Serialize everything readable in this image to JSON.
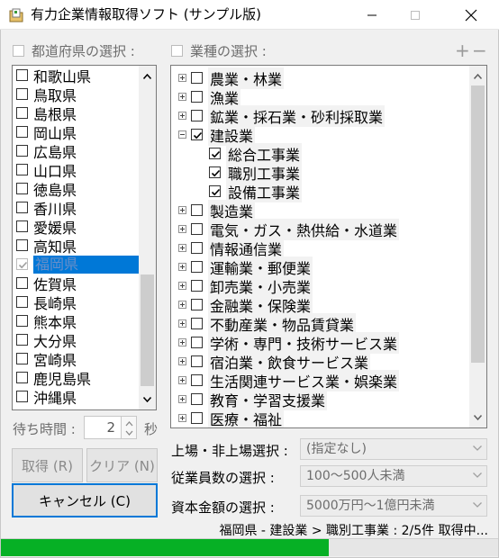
{
  "window": {
    "title": "有力企業情報取得ソフト (サンプル版)"
  },
  "prefectures": {
    "header": "都道府県の選択 :",
    "items": [
      {
        "label": "和歌山県",
        "checked": false
      },
      {
        "label": "鳥取県",
        "checked": false
      },
      {
        "label": "島根県",
        "checked": false
      },
      {
        "label": "岡山県",
        "checked": false
      },
      {
        "label": "広島県",
        "checked": false
      },
      {
        "label": "山口県",
        "checked": false
      },
      {
        "label": "徳島県",
        "checked": false
      },
      {
        "label": "香川県",
        "checked": false
      },
      {
        "label": "愛媛県",
        "checked": false
      },
      {
        "label": "高知県",
        "checked": false
      },
      {
        "label": "福岡県",
        "checked": true,
        "selected": true
      },
      {
        "label": "佐賀県",
        "checked": false
      },
      {
        "label": "長崎県",
        "checked": false
      },
      {
        "label": "熊本県",
        "checked": false
      },
      {
        "label": "大分県",
        "checked": false
      },
      {
        "label": "宮崎県",
        "checked": false
      },
      {
        "label": "鹿児島県",
        "checked": false
      },
      {
        "label": "沖縄県",
        "checked": false
      }
    ]
  },
  "industries": {
    "header": "業種の選択 :",
    "add_symbol": "+",
    "remove_symbol": "−",
    "items": [
      {
        "label": "農業・林業",
        "level": 0,
        "expander": "plus",
        "checked": false
      },
      {
        "label": "漁業",
        "level": 0,
        "expander": "plus",
        "checked": false
      },
      {
        "label": "鉱業・採石業・砂利採取業",
        "level": 0,
        "expander": "plus",
        "checked": false
      },
      {
        "label": "建設業",
        "level": 0,
        "expander": "minus",
        "checked": true
      },
      {
        "label": "総合工事業",
        "level": 1,
        "expander": "none",
        "checked": true
      },
      {
        "label": "職別工事業",
        "level": 1,
        "expander": "none",
        "checked": true
      },
      {
        "label": "設備工事業",
        "level": 1,
        "expander": "none",
        "checked": true
      },
      {
        "label": "製造業",
        "level": 0,
        "expander": "plus",
        "checked": false
      },
      {
        "label": "電気・ガス・熱供給・水道業",
        "level": 0,
        "expander": "plus",
        "checked": false
      },
      {
        "label": "情報通信業",
        "level": 0,
        "expander": "plus",
        "checked": false
      },
      {
        "label": "運輸業・郵便業",
        "level": 0,
        "expander": "plus",
        "checked": false
      },
      {
        "label": "卸売業・小売業",
        "level": 0,
        "expander": "plus",
        "checked": false
      },
      {
        "label": "金融業・保険業",
        "level": 0,
        "expander": "plus",
        "checked": false
      },
      {
        "label": "不動産業・物品賃貸業",
        "level": 0,
        "expander": "plus",
        "checked": false
      },
      {
        "label": "学術・専門・技術サービス業",
        "level": 0,
        "expander": "plus",
        "checked": false
      },
      {
        "label": "宿泊業・飲食サービス業",
        "level": 0,
        "expander": "plus",
        "checked": false
      },
      {
        "label": "生活関連サービス業・娯楽業",
        "level": 0,
        "expander": "plus",
        "checked": false
      },
      {
        "label": "教育・学習支援業",
        "level": 0,
        "expander": "plus",
        "checked": false
      },
      {
        "label": "医療・福祉",
        "level": 0,
        "expander": "plus",
        "checked": false
      }
    ]
  },
  "wait": {
    "label": "待ち時間 :",
    "value": "2",
    "unit": "秒"
  },
  "buttons": {
    "fetch": "取得 (R)",
    "clear": "クリア (N)",
    "cancel": "キャンセル (C)"
  },
  "filters": {
    "listing_label": "上場・非上場選択 :",
    "listing_value": "(指定なし)",
    "employees_label": "従業員数の選択 :",
    "employees_value": "100～500人未満",
    "capital_label": "資本金額の選択 :",
    "capital_value": "5000万円～1億円未満"
  },
  "status": {
    "text": "福岡県 - 建設業 > 職別工事業 : 2/5件 取得中...",
    "progress_fraction": 0.66
  },
  "colors": {
    "selection": "#0078d7",
    "progress": "#06b025"
  }
}
